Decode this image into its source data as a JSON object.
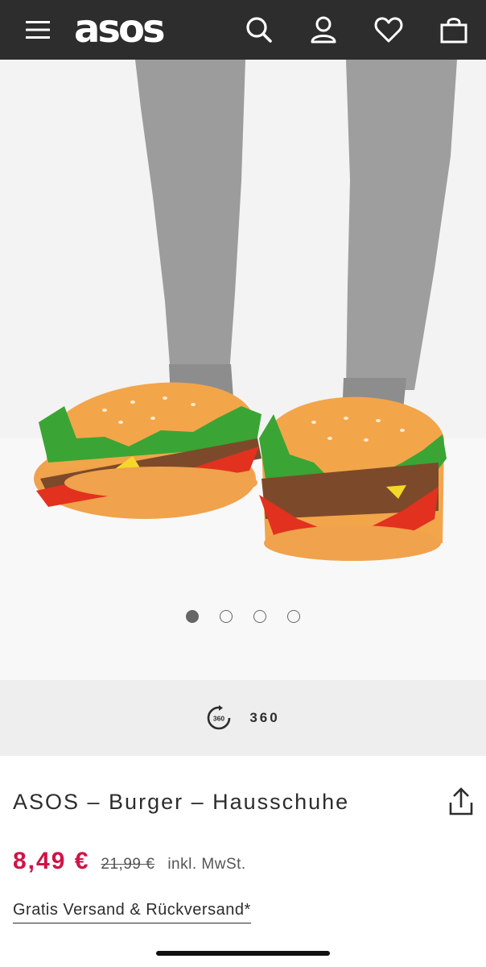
{
  "header": {
    "logo": "asos",
    "menu_icon": "hamburger-menu-icon",
    "search_icon": "search-icon",
    "account_icon": "user-icon",
    "saved_icon": "heart-icon",
    "bag_icon": "shopping-bag-icon",
    "background": "#2d2d2d"
  },
  "gallery": {
    "image_count": 4,
    "active_index": 0
  },
  "view360": {
    "icon": "rotate-360-icon",
    "icon_text": "360",
    "label": "360"
  },
  "product": {
    "title": "ASOS – Burger – Hausschuhe",
    "price": "8,49 €",
    "old_price": "21,99 €",
    "vat_note": "inkl. MwSt.",
    "shipping_link": "Gratis Versand & Rückversand*",
    "share_icon": "share-icon",
    "price_color": "#d01345"
  }
}
